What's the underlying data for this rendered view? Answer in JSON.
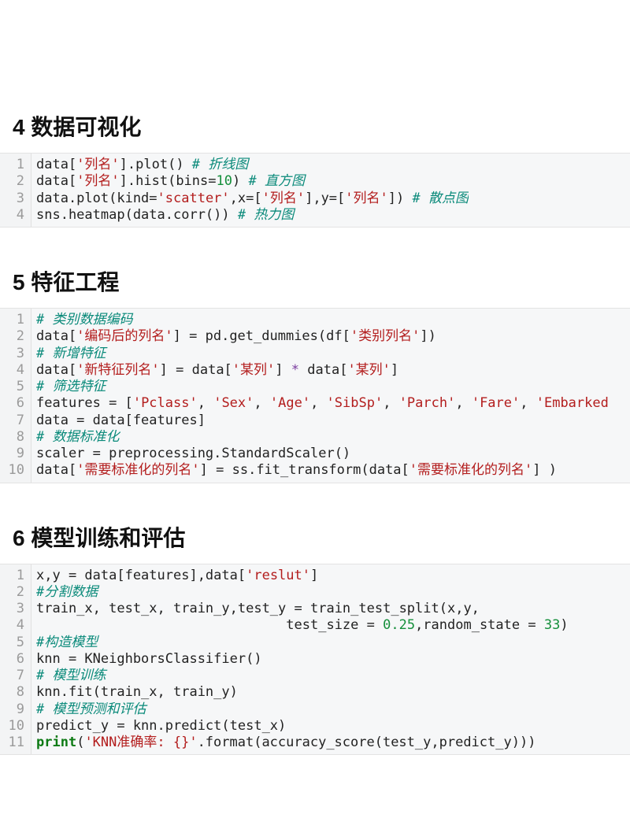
{
  "sections": [
    {
      "number": "4",
      "title": "数据可视化",
      "code_lines": [
        [
          {
            "t": "data[",
            "c": ""
          },
          {
            "t": "'列名'",
            "c": "tok-str"
          },
          {
            "t": "].plot() ",
            "c": ""
          },
          {
            "t": "# 折线图",
            "c": "tok-cmt"
          }
        ],
        [
          {
            "t": "data[",
            "c": ""
          },
          {
            "t": "'列名'",
            "c": "tok-str"
          },
          {
            "t": "].hist(bins=",
            "c": ""
          },
          {
            "t": "10",
            "c": "tok-num"
          },
          {
            "t": ") ",
            "c": ""
          },
          {
            "t": "# 直方图",
            "c": "tok-cmt"
          }
        ],
        [
          {
            "t": "data.plot(kind=",
            "c": ""
          },
          {
            "t": "'scatter'",
            "c": "tok-str"
          },
          {
            "t": ",x=[",
            "c": ""
          },
          {
            "t": "'列名'",
            "c": "tok-str"
          },
          {
            "t": "],y=[",
            "c": ""
          },
          {
            "t": "'列名'",
            "c": "tok-str"
          },
          {
            "t": "]) ",
            "c": ""
          },
          {
            "t": "# 散点图",
            "c": "tok-cmt"
          }
        ],
        [
          {
            "t": "sns.heatmap(data.corr()) ",
            "c": ""
          },
          {
            "t": "# 热力图",
            "c": "tok-cmt"
          }
        ]
      ]
    },
    {
      "number": "5",
      "title": "特征工程",
      "code_lines": [
        [
          {
            "t": "# 类别数据编码",
            "c": "tok-cmt"
          }
        ],
        [
          {
            "t": "data[",
            "c": ""
          },
          {
            "t": "'编码后的列名'",
            "c": "tok-str"
          },
          {
            "t": "] = pd.get_dummies(df[",
            "c": ""
          },
          {
            "t": "'类别列名'",
            "c": "tok-str"
          },
          {
            "t": "])",
            "c": ""
          }
        ],
        [
          {
            "t": "# 新增特征",
            "c": "tok-cmt"
          }
        ],
        [
          {
            "t": "data[",
            "c": ""
          },
          {
            "t": "'新特征列名'",
            "c": "tok-str"
          },
          {
            "t": "] = data[",
            "c": ""
          },
          {
            "t": "'某列'",
            "c": "tok-str"
          },
          {
            "t": "] ",
            "c": ""
          },
          {
            "t": "*",
            "c": "tok-op"
          },
          {
            "t": " data[",
            "c": ""
          },
          {
            "t": "'某列'",
            "c": "tok-str"
          },
          {
            "t": "]",
            "c": ""
          }
        ],
        [
          {
            "t": "# 筛选特征",
            "c": "tok-cmt"
          }
        ],
        [
          {
            "t": "features = [",
            "c": ""
          },
          {
            "t": "'Pclass'",
            "c": "tok-str"
          },
          {
            "t": ", ",
            "c": ""
          },
          {
            "t": "'Sex'",
            "c": "tok-str"
          },
          {
            "t": ", ",
            "c": ""
          },
          {
            "t": "'Age'",
            "c": "tok-str"
          },
          {
            "t": ", ",
            "c": ""
          },
          {
            "t": "'SibSp'",
            "c": "tok-str"
          },
          {
            "t": ", ",
            "c": ""
          },
          {
            "t": "'Parch'",
            "c": "tok-str"
          },
          {
            "t": ", ",
            "c": ""
          },
          {
            "t": "'Fare'",
            "c": "tok-str"
          },
          {
            "t": ", ",
            "c": ""
          },
          {
            "t": "'Embarked",
            "c": "tok-str"
          }
        ],
        [
          {
            "t": "data = data[features]",
            "c": ""
          }
        ],
        [
          {
            "t": "# 数据标准化",
            "c": "tok-cmt"
          }
        ],
        [
          {
            "t": "scaler = preprocessing.StandardScaler()",
            "c": ""
          }
        ],
        [
          {
            "t": "data[",
            "c": ""
          },
          {
            "t": "'需要标准化的列名'",
            "c": "tok-str"
          },
          {
            "t": "] = ss.fit_transform(data[",
            "c": ""
          },
          {
            "t": "'需要标准化的列名'",
            "c": "tok-str"
          },
          {
            "t": "] )",
            "c": ""
          }
        ]
      ]
    },
    {
      "number": "6",
      "title": "模型训练和评估",
      "code_lines": [
        [
          {
            "t": "x,y = data[features],data[",
            "c": ""
          },
          {
            "t": "'reslut'",
            "c": "tok-str"
          },
          {
            "t": "]",
            "c": ""
          }
        ],
        [
          {
            "t": "#分割数据",
            "c": "tok-cmt"
          }
        ],
        [
          {
            "t": "train_x, test_x, train_y,test_y = train_test_split(x,y,",
            "c": ""
          }
        ],
        [
          {
            "t": "                               test_size = ",
            "c": ""
          },
          {
            "t": "0.25",
            "c": "tok-num"
          },
          {
            "t": ",random_state = ",
            "c": ""
          },
          {
            "t": "33",
            "c": "tok-num"
          },
          {
            "t": ")",
            "c": ""
          }
        ],
        [
          {
            "t": "#构造模型",
            "c": "tok-cmt"
          }
        ],
        [
          {
            "t": "knn = KNeighborsClassifier()",
            "c": ""
          }
        ],
        [
          {
            "t": "# 模型训练",
            "c": "tok-cmt"
          }
        ],
        [
          {
            "t": "knn.fit(train_x, train_y)",
            "c": ""
          }
        ],
        [
          {
            "t": "# 模型预测和评估",
            "c": "tok-cmt"
          }
        ],
        [
          {
            "t": "predict_y = knn.predict(test_x)",
            "c": ""
          }
        ],
        [
          {
            "t": "print",
            "c": "tok-kw"
          },
          {
            "t": "(",
            "c": ""
          },
          {
            "t": "'KNN准确率: {}'",
            "c": "tok-str"
          },
          {
            "t": ".format(accuracy_score(test_y,predict_y)))",
            "c": ""
          }
        ]
      ]
    }
  ]
}
